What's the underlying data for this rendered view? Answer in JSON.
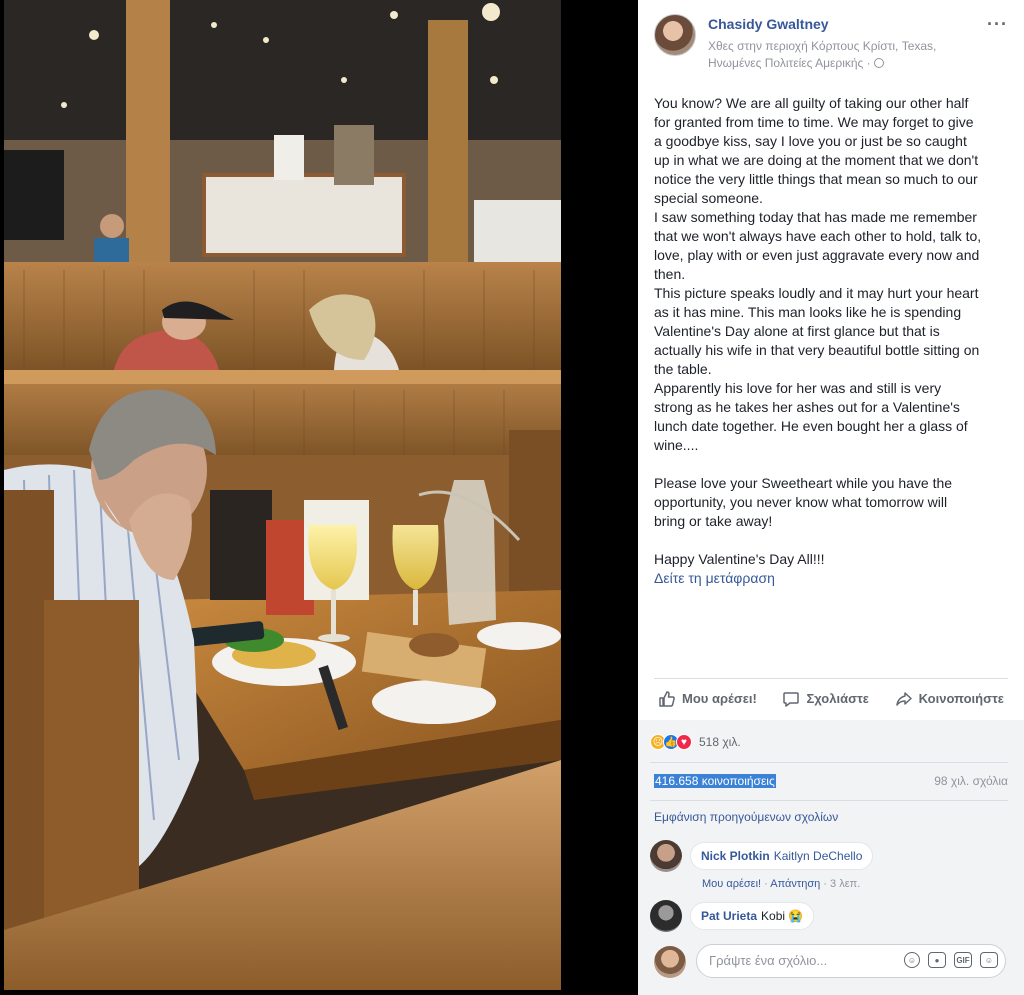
{
  "post": {
    "author": "Chasidy Gwaltney",
    "meta_line1": "Χθες στην περιοχή Κόρπους Κρίστι, Texas,",
    "meta_line2": "Ηνωμένες Πολιτείες Αμερικής · ",
    "more_icon": "···",
    "text": "You know? We are all guilty of taking our other half\nfor granted from time to time. We may forget to give\na goodbye kiss, say I love you or just be so caught\nup in what we are doing at the moment that we don't\nnotice the very little things that mean so much to our\nspecial someone.\nI saw something today that has made me remember\nthat we won't always have each other to hold, talk to,\nlove, play with or even just aggravate every now and\nthen.\nThis picture speaks loudly and it may hurt your heart\nas it has mine. This man looks like he is spending\nValentine's Day alone at first glance but that is\nactually his wife in that very beautiful bottle sitting on\nthe table.\nApparently his love for her was and still is very\nstrong as he takes her ashes out for a Valentine's\nlunch date together. He even bought her a glass of\nwine....\n\nPlease love your Sweetheart while you have the\nopportunity, you never know what tomorrow will\nbring or take away!\n\nHappy Valentine's Day All!!!",
    "translate": "Δείτε τη μετάφραση"
  },
  "actions": {
    "like": "Μου αρέσει!",
    "comment": "Σχολιάστε",
    "share": "Κοινοποιήστε"
  },
  "stats": {
    "reactions": "518 χιλ.",
    "shares": "416.658 κοινοποιήσεις",
    "comments": "98 χιλ. σχόλια",
    "previous": "Εμφάνιση προηγούμενων σχολίων"
  },
  "comments": [
    {
      "name": "Nick Plotkin",
      "text": "Kaitlyn DeChello",
      "like": "Μου αρέσει!",
      "reply": "Απάντηση",
      "time": "3 λεπ."
    },
    {
      "name": "Pat Urieta",
      "text": "Kobi 😭"
    }
  ],
  "composer": {
    "placeholder": "Γράψτε ένα σχόλιο..."
  },
  "colors": {
    "link": "#365899",
    "background": "#f2f3f5"
  }
}
